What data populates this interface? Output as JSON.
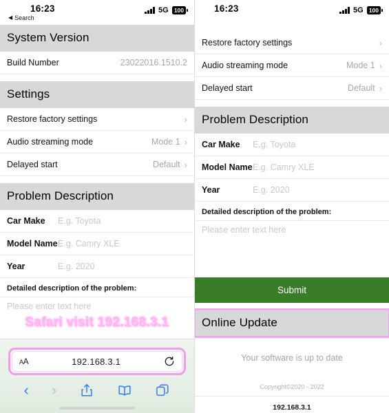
{
  "statusbar": {
    "time": "16:23",
    "back_label": "Search",
    "back_arrow": "◀",
    "network": "5G",
    "battery": "100",
    "signal_icon": "cellular-signal-icon",
    "battery_icon": "battery-icon"
  },
  "left": {
    "sections": {
      "system_version": "System Version",
      "settings": "Settings",
      "problem_description": "Problem Description"
    },
    "build": {
      "label": "Build Number",
      "value": "23022016.1510.2"
    },
    "settings_rows": [
      {
        "label": "Restore factory settings",
        "value": "",
        "chevron": "›"
      },
      {
        "label": "Audio streaming mode",
        "value": "Mode 1",
        "chevron": "›"
      },
      {
        "label": "Delayed start",
        "value": "Default",
        "chevron": "›"
      }
    ],
    "fields": [
      {
        "label": "Car Make",
        "value": "",
        "placeholder": "E.g. Toyota"
      },
      {
        "label": "Model Name",
        "value": "",
        "placeholder": "E.g. Camry XLE"
      },
      {
        "label": "Year",
        "value": "",
        "placeholder": "E.g. 2020"
      }
    ],
    "detail_label": "Detailed description of the problem:",
    "detail_placeholder": "Please enter text here",
    "annotation": "Safari visit 192.168.3.1",
    "safari": {
      "aa_label": "AA",
      "url": "192.168.3.1",
      "reload_icon": "reload-icon",
      "back_icon": "back-chevron-icon",
      "forward_icon": "forward-chevron-icon",
      "share_icon": "share-icon",
      "bookmarks_icon": "book-icon",
      "tabs_icon": "tabs-icon"
    }
  },
  "right": {
    "settings_rows": [
      {
        "label": "Restore factory settings",
        "value": "",
        "chevron": "›"
      },
      {
        "label": "Audio streaming mode",
        "value": "Mode 1",
        "chevron": "›"
      },
      {
        "label": "Delayed start",
        "value": "Default",
        "chevron": "›"
      }
    ],
    "sections": {
      "problem_description": "Problem Description",
      "online_update": "Online Update"
    },
    "fields": [
      {
        "label": "Car Make",
        "value": "",
        "placeholder": "E.g. Toyota"
      },
      {
        "label": "Model Name",
        "value": "",
        "placeholder": "E.g. Camry XLE"
      },
      {
        "label": "Year",
        "value": "",
        "placeholder": "E.g. 2020"
      }
    ],
    "detail_label": "Detailed description of the problem:",
    "detail_placeholder": "Please enter text here",
    "submit_label": "Submit",
    "update_status": "Your software is up to date",
    "copyright": "Copyright©2020 - 2022",
    "page_host": "192.168.3.1"
  },
  "colors": {
    "section_header_bg": "#d8d8d8",
    "submit_green": "#3a7d28",
    "highlight_pink": "#ef9fe8",
    "annotation_pink": "#ffb7f2",
    "link_blue": "#3b7ff0"
  }
}
